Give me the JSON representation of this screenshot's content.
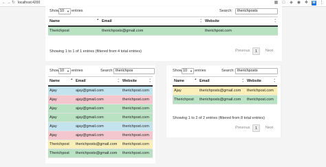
{
  "browser": {
    "url": "localhost:4200",
    "profile_initial": "M"
  },
  "colors": {
    "green": "#b9e2c3",
    "blue": "#c3e3ee",
    "pink": "#f3c7cd",
    "yellow": "#fbefb9",
    "gray": "#e6e6e6"
  },
  "tables": [
    {
      "show_label": "Show",
      "page_size": "10",
      "entries_label": "entries",
      "search_label": "Search:",
      "search_value": "therichposts",
      "columns": [
        "Name",
        "Email",
        "Website"
      ],
      "rows": [
        {
          "name": "Therichpost",
          "email": "therichposts@gmail.com",
          "website": "therichpost.com",
          "color": "green"
        }
      ],
      "info": "Showing 1 to 1 of 1 entries (filtered from 4 total entries)",
      "prev": "Previous",
      "page": "1",
      "next": "Next"
    },
    {
      "show_label": "Show",
      "page_size": "10",
      "entries_label": "entries",
      "search_label": "Search:",
      "search_value": "therichpos",
      "columns": [
        "Name",
        "Email",
        "Website"
      ],
      "rows": [
        {
          "name": "Ajay",
          "email": "ajay@gmail.com",
          "website": "therichpost.com",
          "color": "blue"
        },
        {
          "name": "Ajay",
          "email": "ajay@gmail.com",
          "website": "therichpost.com",
          "color": "pink"
        },
        {
          "name": "Ajay",
          "email": "ajay@gmail.com",
          "website": "therichpost.com",
          "color": "green"
        },
        {
          "name": "Ajay",
          "email": "ajay@gmail.com",
          "website": "therichpost.com",
          "color": "green"
        },
        {
          "name": "Ajay",
          "email": "ajay@gmail.com",
          "website": "therichpost.com",
          "color": "blue"
        },
        {
          "name": "Ajay",
          "email": "ajay@gmail.com",
          "website": "therichpost.com",
          "color": "pink"
        },
        {
          "name": "Therichpost",
          "email": "therichposts@gmail.com",
          "website": "therichpost.com",
          "color": "yellow"
        },
        {
          "name": "Therichpost",
          "email": "therichposts@gmail.com",
          "website": "therichpost.com",
          "color": "green"
        }
      ]
    },
    {
      "show_label": "Show",
      "page_size": "10",
      "entries_label": "entries",
      "search_label": "Search:",
      "search_value": "therichposts",
      "columns": [
        "Name",
        "Email",
        "Website"
      ],
      "rows": [
        {
          "name": "Ajay",
          "email": "therichposts@gmail.com",
          "website": "therichpost.com",
          "color": "yellow"
        },
        {
          "name": "Therichpost",
          "email": "therichposts@gmail.com",
          "website": "therichpost.com",
          "color": "green"
        }
      ],
      "info": "Showing 1 to 2 of 2 entries (filtered from 8 total entries)",
      "prev": "Previous",
      "page": "1",
      "next": "Next"
    }
  ]
}
